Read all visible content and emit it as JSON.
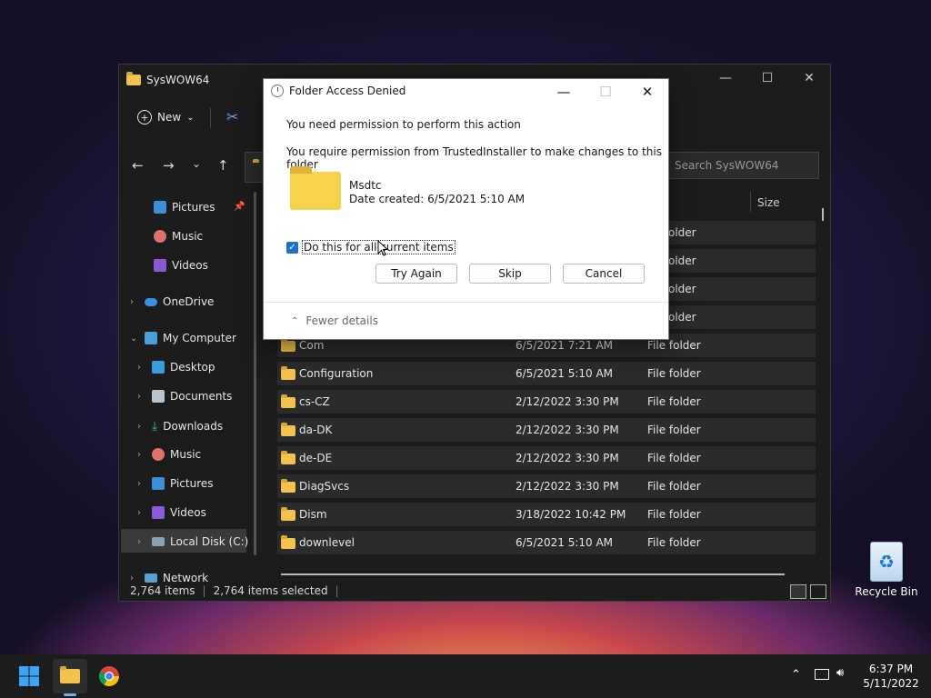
{
  "explorer": {
    "title": "SysWOW64",
    "toolbar": {
      "new_label": "New",
      "new_arrow": "⌄"
    },
    "search_placeholder": "Search SysWOW64",
    "column_size": "Size",
    "nav": [
      {
        "label": "Pictures",
        "icon": "pictures-icon",
        "pinned": true
      },
      {
        "label": "Music",
        "icon": "music-icon"
      },
      {
        "label": "Videos",
        "icon": "videos-icon"
      },
      {
        "label": "OneDrive",
        "icon": "onedrive-icon"
      },
      {
        "label": "My Computer",
        "icon": "computer-icon"
      },
      {
        "label": "Desktop",
        "icon": "desktop-icon"
      },
      {
        "label": "Documents",
        "icon": "documents-icon"
      },
      {
        "label": "Downloads",
        "icon": "downloads-icon"
      },
      {
        "label": "Music",
        "icon": "music-icon"
      },
      {
        "label": "Pictures",
        "icon": "pictures-icon"
      },
      {
        "label": "Videos",
        "icon": "videos-icon"
      },
      {
        "label": "Local Disk (C:)",
        "icon": "disk-icon"
      },
      {
        "label": "Network",
        "icon": "network-icon"
      }
    ],
    "partial_rows": [
      {
        "type": "older"
      },
      {
        "type": "older"
      },
      {
        "type": "older"
      },
      {
        "type": "older"
      }
    ],
    "partial_type_fragment": "older",
    "rows": [
      {
        "name": "Com",
        "date": "6/5/2021 7:21 AM",
        "type": "File folder"
      },
      {
        "name": "Configuration",
        "date": "6/5/2021 5:10 AM",
        "type": "File folder"
      },
      {
        "name": "cs-CZ",
        "date": "2/12/2022 3:30 PM",
        "type": "File folder"
      },
      {
        "name": "da-DK",
        "date": "2/12/2022 3:30 PM",
        "type": "File folder"
      },
      {
        "name": "de-DE",
        "date": "2/12/2022 3:30 PM",
        "type": "File folder"
      },
      {
        "name": "DiagSvcs",
        "date": "2/12/2022 3:30 PM",
        "type": "File folder"
      },
      {
        "name": "Dism",
        "date": "3/18/2022 10:42 PM",
        "type": "File folder"
      },
      {
        "name": "downlevel",
        "date": "6/5/2021 5:10 AM",
        "type": "File folder"
      }
    ],
    "status": {
      "items": "2,764 items",
      "selected": "2,764 items selected",
      "sep": "|"
    }
  },
  "dialog": {
    "title": "Folder Access Denied",
    "line1": "You need permission to perform this action",
    "line2": "You require permission from TrustedInstaller to make changes to this folder",
    "item_name": "Msdtc",
    "item_date": "Date created: 6/5/2021 5:10 AM",
    "checkbox_label": "Do this for all current items",
    "checkbox_checked": true,
    "try_again": "Try Again",
    "skip": "Skip",
    "cancel": "Cancel",
    "fewer_details": "Fewer details"
  },
  "desktop": {
    "recycle_bin": "Recycle Bin"
  },
  "taskbar": {
    "time": "6:37 PM",
    "date": "5/11/2022"
  }
}
